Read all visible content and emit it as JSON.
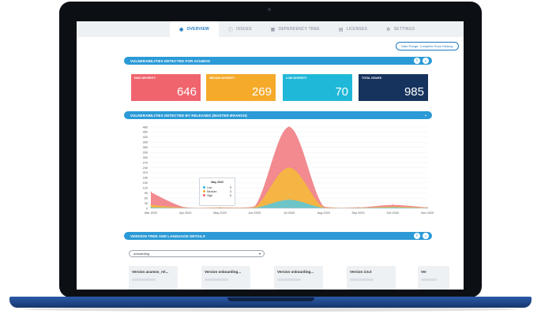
{
  "nav": {
    "tabs": [
      {
        "label": "OVERVIEW",
        "icon": "shield-icon",
        "active": true
      },
      {
        "label": "ISSUES",
        "icon": "alert-icon",
        "active": false
      },
      {
        "label": "DEPENDENCY TREE",
        "icon": "tree-icon",
        "active": false
      },
      {
        "label": "LICENSES",
        "icon": "document-icon",
        "active": false
      },
      {
        "label": "SETTINGS",
        "icon": "gear-icon",
        "active": false
      }
    ]
  },
  "date_range": {
    "label": "Date Range: Complete Scan History"
  },
  "sections": {
    "vulnerabilities": {
      "title": "VULNERABILITIES DETECTED FOR ACUMOS"
    },
    "releases": {
      "title": "VULNERABILITIES DETECTED BY RELEASES (MASTER BRANCH)"
    },
    "versions": {
      "title": "VERSION TREE AND LANGUAGE DETAILS"
    }
  },
  "cards": [
    {
      "label": "HIGH SEVERITY",
      "value": "646",
      "color": "#f0646e"
    },
    {
      "label": "MEDIUM SEVERITY",
      "value": "269",
      "color": "#f5aa2a"
    },
    {
      "label": "LOW SEVERITY",
      "value": "70",
      "color": "#20b8d8"
    },
    {
      "label": "TOTAL ISSUES",
      "value": "985",
      "color": "#16335e"
    }
  ],
  "chart_data": {
    "type": "area",
    "categories": [
      "Mar 2020",
      "Apr 2020",
      "May 2020",
      "Jun 2020",
      "Jul 2020",
      "Aug 2020",
      "Sep 2020",
      "Oct 2020",
      "Nov 2020"
    ],
    "y_ticks": [
      0,
      30,
      60,
      90,
      120,
      150,
      180,
      210,
      240,
      270,
      300,
      330,
      360,
      390,
      420,
      450,
      480
    ],
    "ylim": [
      0,
      480
    ],
    "grid": true,
    "series": [
      {
        "name": "High",
        "color": "#f0757c",
        "values": [
          95,
          5,
          5,
          10,
          480,
          10,
          5,
          20,
          5
        ]
      },
      {
        "name": "Medium",
        "color": "#f5b93c",
        "values": [
          20,
          3,
          3,
          5,
          240,
          5,
          3,
          10,
          3
        ]
      },
      {
        "name": "Low",
        "color": "#5fc7d6",
        "values": [
          5,
          1,
          0,
          2,
          50,
          2,
          1,
          5,
          1
        ]
      }
    ]
  },
  "tooltip": {
    "title": "May 2020",
    "rows": [
      {
        "name": "Low",
        "value": "0",
        "color": "#20b8d8"
      },
      {
        "name": "Medium",
        "value": "3",
        "color": "#f5aa2a"
      },
      {
        "name": "High",
        "value": "5",
        "color": "#f0646e"
      }
    ]
  },
  "branch_select": {
    "value": "onboarding"
  },
  "version_cards": [
    {
      "label": "Version acumos_rel..."
    },
    {
      "label": "Version onboarding..."
    },
    {
      "label": "Version onboarding..."
    },
    {
      "label": "Version 3.5.0"
    },
    {
      "label": "Ver"
    }
  ]
}
